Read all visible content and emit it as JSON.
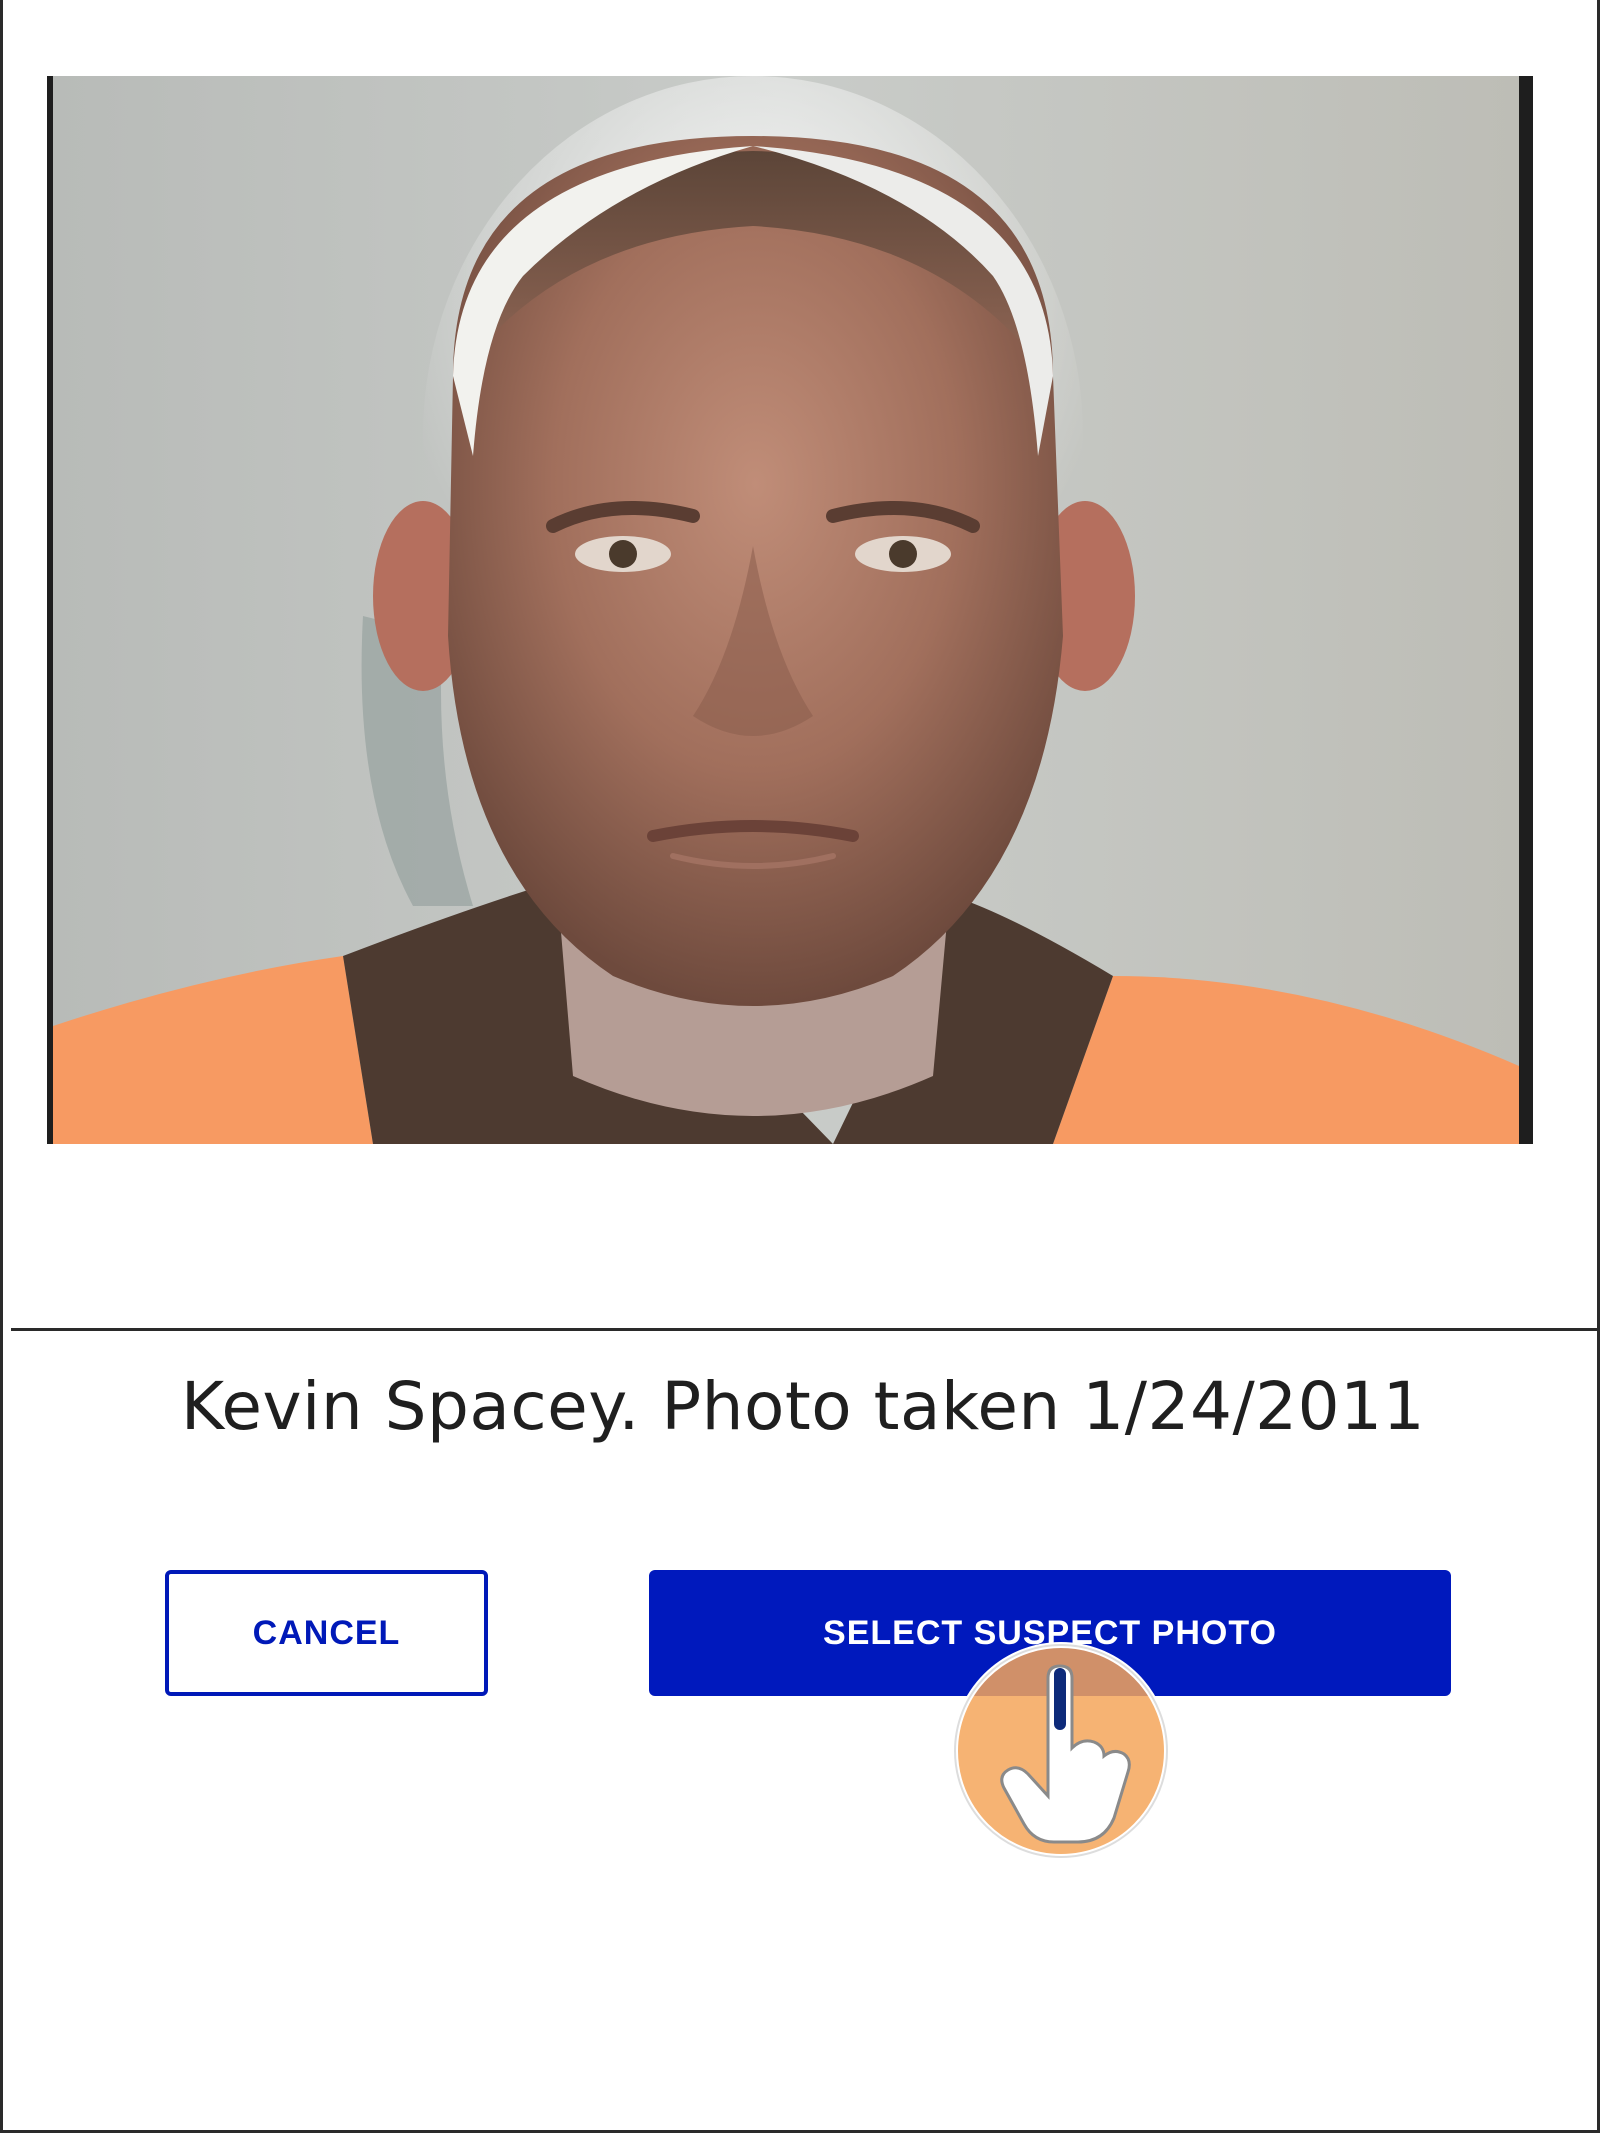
{
  "photo": {
    "alt": "Suspect mugshot photo"
  },
  "caption": {
    "text": "Kevin Spacey. Photo taken 1/24/2011"
  },
  "actions": {
    "cancel_label": "CANCEL",
    "select_label": "SELECT SUSPECT PHOTO"
  },
  "colors": {
    "accent": "#0019bd",
    "pointer": "#f5a65b",
    "divider": "#2a2a2a"
  },
  "icons": {
    "pointer": "tap-hand-icon"
  }
}
